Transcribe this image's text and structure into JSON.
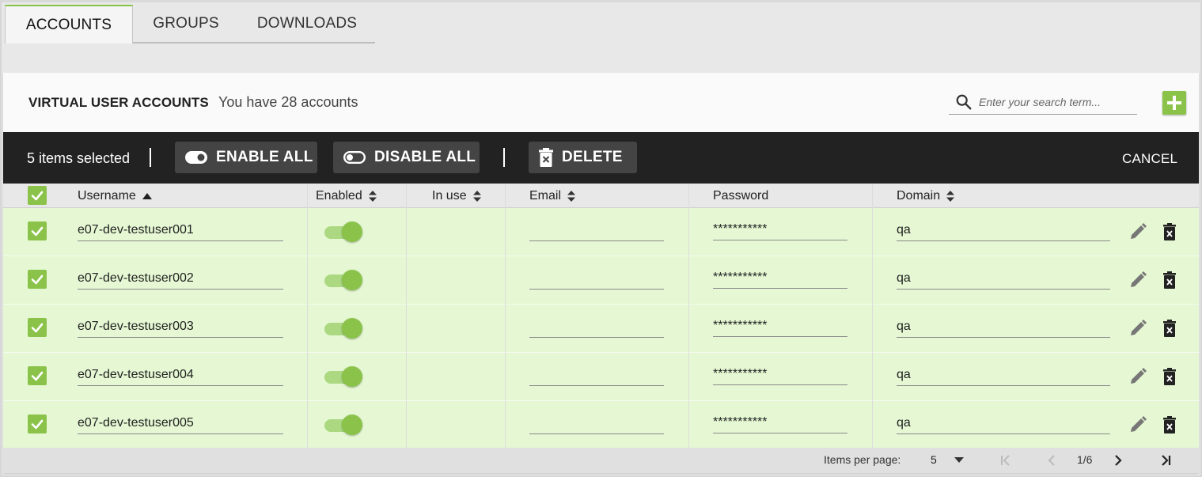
{
  "tabs": [
    {
      "label": "ACCOUNTS",
      "active": true
    },
    {
      "label": "GROUPS",
      "active": false
    },
    {
      "label": "DOWNLOADS",
      "active": false
    }
  ],
  "header": {
    "title": "VIRTUAL USER ACCOUNTS",
    "subtitle": "You have 28 accounts",
    "search_placeholder": "Enter your search term..."
  },
  "selection_bar": {
    "count_text": "5 items selected",
    "enable_all_label": "ENABLE ALL",
    "disable_all_label": "DISABLE ALL",
    "delete_label": "DELETE",
    "cancel_label": "CANCEL"
  },
  "columns": [
    "Username",
    "Enabled",
    "In use",
    "Email",
    "Password",
    "Domain"
  ],
  "rows": [
    {
      "username": "e07-dev-testuser001",
      "enabled": true,
      "in_use": "",
      "email": "",
      "password": "***********",
      "domain": "qa",
      "selected": true
    },
    {
      "username": "e07-dev-testuser002",
      "enabled": true,
      "in_use": "",
      "email": "",
      "password": "***********",
      "domain": "qa",
      "selected": true
    },
    {
      "username": "e07-dev-testuser003",
      "enabled": true,
      "in_use": "",
      "email": "",
      "password": "***********",
      "domain": "qa",
      "selected": true
    },
    {
      "username": "e07-dev-testuser004",
      "enabled": true,
      "in_use": "",
      "email": "",
      "password": "***********",
      "domain": "qa",
      "selected": true
    },
    {
      "username": "e07-dev-testuser005",
      "enabled": true,
      "in_use": "",
      "email": "",
      "password": "***********",
      "domain": "qa",
      "selected": true
    }
  ],
  "footer": {
    "items_per_page_label": "Items per page:",
    "items_per_page_value": "5",
    "page_info": "1/6"
  },
  "colors": {
    "accent": "#8bc34a",
    "row_selected_bg": "#e5f8d3",
    "selection_bar_bg": "#222222"
  }
}
